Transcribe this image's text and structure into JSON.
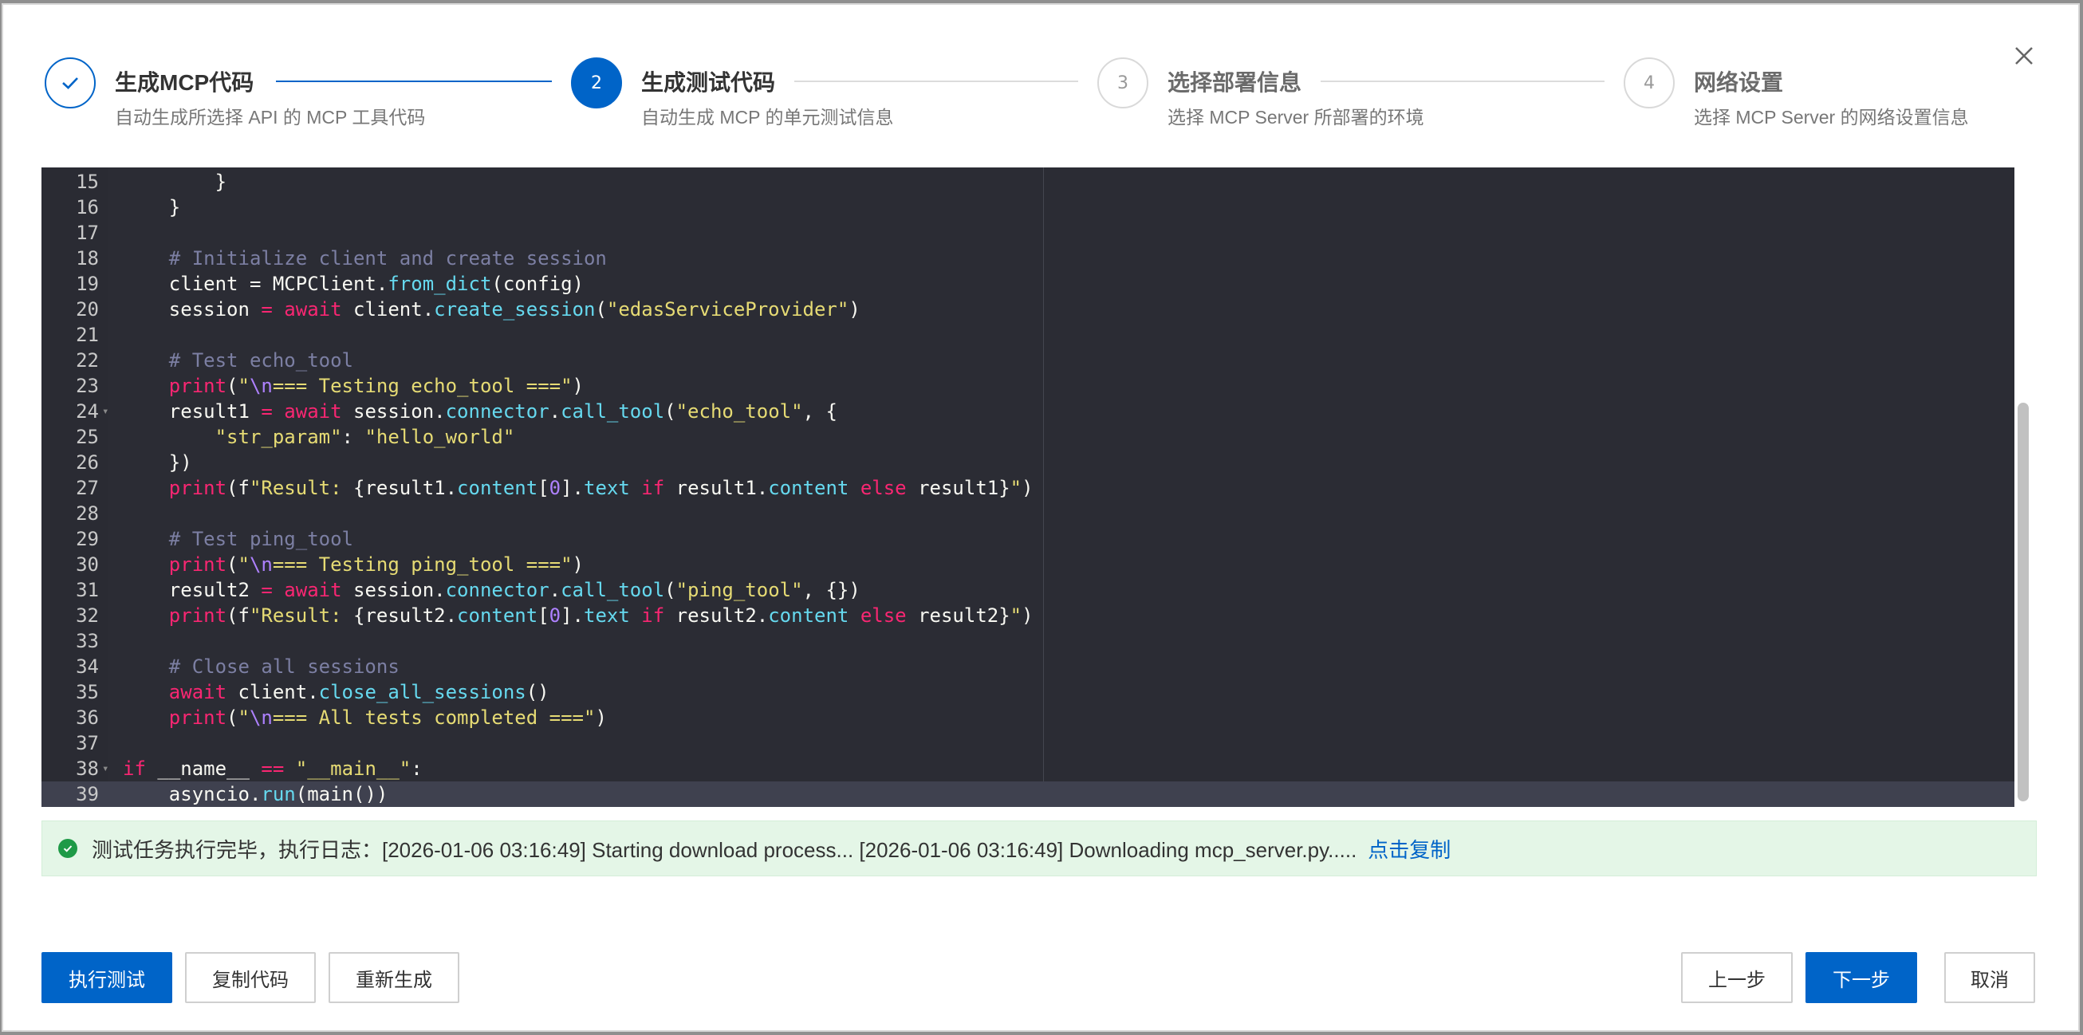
{
  "steps": [
    {
      "number": "1",
      "title": "生成MCP代码",
      "desc": "自动生成所选择 API 的 MCP 工具代码",
      "state": "done"
    },
    {
      "number": "2",
      "title": "生成测试代码",
      "desc": "自动生成 MCP 的单元测试信息",
      "state": "active"
    },
    {
      "number": "3",
      "title": "选择部署信息",
      "desc": "选择 MCP Server 所部署的环境",
      "state": "todo"
    },
    {
      "number": "4",
      "title": "网络设置",
      "desc": "选择 MCP Server 的网络设置信息",
      "state": "todo"
    }
  ],
  "editor": {
    "active_line": "39",
    "lines": [
      {
        "n": "15",
        "tokens": [
          [
            "plain",
            "        }"
          ]
        ]
      },
      {
        "n": "16",
        "tokens": [
          [
            "plain",
            "    }"
          ]
        ]
      },
      {
        "n": "17",
        "tokens": []
      },
      {
        "n": "18",
        "tokens": [
          [
            "plain",
            "    "
          ],
          [
            "comment",
            "# Initialize client and create session"
          ]
        ]
      },
      {
        "n": "19",
        "tokens": [
          [
            "plain",
            "    client = MCPClient."
          ],
          [
            "fn",
            "from_dict"
          ],
          [
            "plain",
            "(config)"
          ]
        ]
      },
      {
        "n": "20",
        "tokens": [
          [
            "plain",
            "    session "
          ],
          [
            "kw",
            "="
          ],
          [
            "plain",
            " "
          ],
          [
            "kw",
            "await"
          ],
          [
            "plain",
            " client."
          ],
          [
            "fn",
            "create_session"
          ],
          [
            "plain",
            "("
          ],
          [
            "str",
            "\"edasServiceProvider\""
          ],
          [
            "plain",
            ")"
          ]
        ]
      },
      {
        "n": "21",
        "tokens": []
      },
      {
        "n": "22",
        "tokens": [
          [
            "plain",
            "    "
          ],
          [
            "comment",
            "# Test echo_tool"
          ]
        ]
      },
      {
        "n": "23",
        "tokens": [
          [
            "plain",
            "    "
          ],
          [
            "kw",
            "print"
          ],
          [
            "plain",
            "("
          ],
          [
            "str",
            "\""
          ],
          [
            "esc",
            "\\n"
          ],
          [
            "str",
            "=== Testing echo_tool ===\""
          ],
          [
            "plain",
            ")"
          ]
        ]
      },
      {
        "n": "24",
        "fold": true,
        "tokens": [
          [
            "plain",
            "    result1 "
          ],
          [
            "kw",
            "="
          ],
          [
            "plain",
            " "
          ],
          [
            "kw",
            "await"
          ],
          [
            "plain",
            " session."
          ],
          [
            "prop",
            "connector"
          ],
          [
            "plain",
            "."
          ],
          [
            "fn",
            "call_tool"
          ],
          [
            "plain",
            "("
          ],
          [
            "str",
            "\"echo_tool\""
          ],
          [
            "plain",
            ", {"
          ]
        ]
      },
      {
        "n": "25",
        "tokens": [
          [
            "plain",
            "        "
          ],
          [
            "str",
            "\"str_param\""
          ],
          [
            "plain",
            ": "
          ],
          [
            "str",
            "\"hello_world\""
          ]
        ]
      },
      {
        "n": "26",
        "tokens": [
          [
            "plain",
            "    })"
          ]
        ]
      },
      {
        "n": "27",
        "tokens": [
          [
            "plain",
            "    "
          ],
          [
            "kw",
            "print"
          ],
          [
            "plain",
            "(f"
          ],
          [
            "str",
            "\"Result: "
          ],
          [
            "plain",
            "{result1."
          ],
          [
            "prop",
            "content"
          ],
          [
            "plain",
            "["
          ],
          [
            "num",
            "0"
          ],
          [
            "plain",
            "]."
          ],
          [
            "prop",
            "text"
          ],
          [
            "plain",
            " "
          ],
          [
            "kw",
            "if"
          ],
          [
            "plain",
            " result1."
          ],
          [
            "prop",
            "content"
          ],
          [
            "plain",
            " "
          ],
          [
            "kw",
            "else"
          ],
          [
            "plain",
            " result1}"
          ],
          [
            "str",
            "\""
          ],
          [
            "plain",
            ")"
          ]
        ]
      },
      {
        "n": "28",
        "tokens": []
      },
      {
        "n": "29",
        "tokens": [
          [
            "plain",
            "    "
          ],
          [
            "comment",
            "# Test ping_tool"
          ]
        ]
      },
      {
        "n": "30",
        "tokens": [
          [
            "plain",
            "    "
          ],
          [
            "kw",
            "print"
          ],
          [
            "plain",
            "("
          ],
          [
            "str",
            "\""
          ],
          [
            "esc",
            "\\n"
          ],
          [
            "str",
            "=== Testing ping_tool ===\""
          ],
          [
            "plain",
            ")"
          ]
        ]
      },
      {
        "n": "31",
        "tokens": [
          [
            "plain",
            "    result2 "
          ],
          [
            "kw",
            "="
          ],
          [
            "plain",
            " "
          ],
          [
            "kw",
            "await"
          ],
          [
            "plain",
            " session."
          ],
          [
            "prop",
            "connector"
          ],
          [
            "plain",
            "."
          ],
          [
            "fn",
            "call_tool"
          ],
          [
            "plain",
            "("
          ],
          [
            "str",
            "\"ping_tool\""
          ],
          [
            "plain",
            ", {})"
          ]
        ]
      },
      {
        "n": "32",
        "tokens": [
          [
            "plain",
            "    "
          ],
          [
            "kw",
            "print"
          ],
          [
            "plain",
            "(f"
          ],
          [
            "str",
            "\"Result: "
          ],
          [
            "plain",
            "{result2."
          ],
          [
            "prop",
            "content"
          ],
          [
            "plain",
            "["
          ],
          [
            "num",
            "0"
          ],
          [
            "plain",
            "]."
          ],
          [
            "prop",
            "text"
          ],
          [
            "plain",
            " "
          ],
          [
            "kw",
            "if"
          ],
          [
            "plain",
            " result2."
          ],
          [
            "prop",
            "content"
          ],
          [
            "plain",
            " "
          ],
          [
            "kw",
            "else"
          ],
          [
            "plain",
            " result2}"
          ],
          [
            "str",
            "\""
          ],
          [
            "plain",
            ")"
          ]
        ]
      },
      {
        "n": "33",
        "tokens": []
      },
      {
        "n": "34",
        "tokens": [
          [
            "plain",
            "    "
          ],
          [
            "comment",
            "# Close all sessions"
          ]
        ]
      },
      {
        "n": "35",
        "tokens": [
          [
            "plain",
            "    "
          ],
          [
            "kw",
            "await"
          ],
          [
            "plain",
            " client."
          ],
          [
            "fn",
            "close_all_sessions"
          ],
          [
            "plain",
            "()"
          ]
        ]
      },
      {
        "n": "36",
        "tokens": [
          [
            "plain",
            "    "
          ],
          [
            "kw",
            "print"
          ],
          [
            "plain",
            "("
          ],
          [
            "str",
            "\""
          ],
          [
            "esc",
            "\\n"
          ],
          [
            "str",
            "=== All tests completed ===\""
          ],
          [
            "plain",
            ")"
          ]
        ]
      },
      {
        "n": "37",
        "tokens": []
      },
      {
        "n": "38",
        "fold": true,
        "tokens": [
          [
            "kw",
            "if"
          ],
          [
            "plain",
            " __name__ "
          ],
          [
            "kw",
            "=="
          ],
          [
            "plain",
            " "
          ],
          [
            "str",
            "\"__main__\""
          ],
          [
            "plain",
            ":"
          ]
        ]
      },
      {
        "n": "39",
        "tokens": [
          [
            "plain",
            "    asyncio."
          ],
          [
            "fn",
            "run"
          ],
          [
            "plain",
            "(main())"
          ]
        ]
      }
    ]
  },
  "status": {
    "message": "测试任务执行完毕，执行日志：[2026-01-06 03:16:49] Starting download process... [2026-01-06 03:16:49] Downloading mcp_server.py.....",
    "copy_link": "点击复制",
    "color": "#1e9a47"
  },
  "buttons": {
    "run_test": "执行测试",
    "copy_code": "复制代码",
    "regenerate": "重新生成",
    "prev": "上一步",
    "next": "下一步",
    "cancel": "取消"
  },
  "colors": {
    "primary": "#0064c8",
    "success_bg": "#e4f6e7"
  }
}
